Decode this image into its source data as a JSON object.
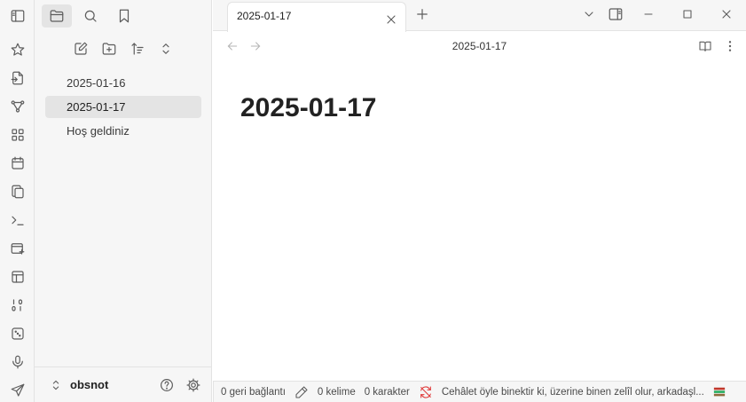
{
  "ribbon": {
    "toggle_icon": "sidebar-left-icon",
    "icons": [
      "star-icon",
      "file-import-icon",
      "graph-icon",
      "grid-icon",
      "calendar-icon",
      "copy-icon",
      "terminal-icon",
      "card-add-icon",
      "layout-icon",
      "binary-icon",
      "dice-icon",
      "microphone-icon",
      "send-icon"
    ]
  },
  "sidebar": {
    "tabs": [
      "folder-icon",
      "search-icon",
      "bookmark-icon"
    ],
    "toolbar": [
      "new-note-icon",
      "new-folder-icon",
      "sort-icon",
      "collapse-icon"
    ],
    "files": [
      {
        "name": "2025-01-16",
        "active": false
      },
      {
        "name": "2025-01-17",
        "active": true
      },
      {
        "name": "Hoş geldiniz",
        "active": false
      }
    ],
    "vault_name": "obsnot"
  },
  "tabbar": {
    "tab_title": "2025-01-17"
  },
  "view": {
    "title": "2025-01-17",
    "note_heading": "2025-01-17"
  },
  "status": {
    "backlinks": "0 geri bağlantı",
    "words": "0 kelime",
    "chars": "0 karakter",
    "quote": "Cehâlet öyle binektir ki, üzerine binen zelîl olur, arkadaşl..."
  },
  "colors": {
    "accent_red": "#e03b3b",
    "sidebar_bg": "#f6f6f6",
    "active_bg": "#e4e4e4"
  }
}
